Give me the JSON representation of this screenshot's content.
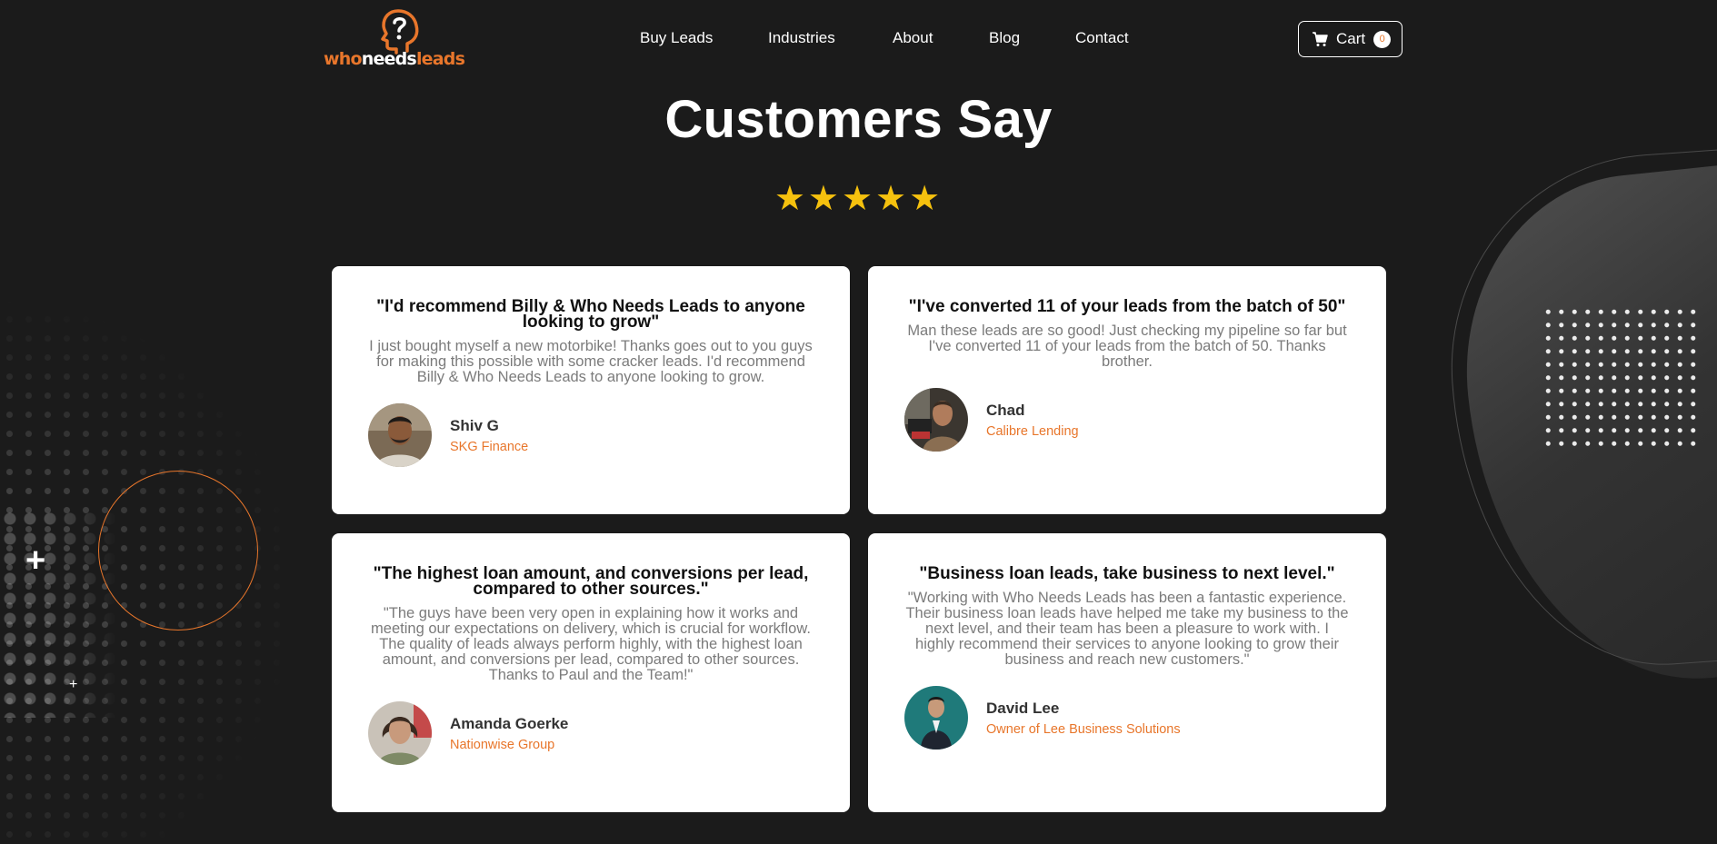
{
  "brand": {
    "logo_part1": "who",
    "logo_part2": "needs",
    "logo_part3": "leads",
    "accent": "#e8762b"
  },
  "nav": [
    {
      "label": "Buy Leads"
    },
    {
      "label": "Industries"
    },
    {
      "label": "About"
    },
    {
      "label": "Blog"
    },
    {
      "label": "Contact"
    }
  ],
  "cart": {
    "label": "Cart",
    "count": "0",
    "icon": "cart-icon"
  },
  "section": {
    "title": "Customers Say",
    "stars": "★★★★★",
    "rating": 5
  },
  "testimonials": [
    {
      "title": "\"I'd recommend Billy & Who Needs Leads to anyone looking to grow\"",
      "body": "I just bought myself a new motorbike! Thanks goes out to you guys for making this possible with some cracker leads. I'd recommend Billy & Who Needs Leads to anyone looking to grow.",
      "name": "Shiv G",
      "company": "SKG Finance"
    },
    {
      "title": "\"I've converted 11 of your leads from the batch of 50\"",
      "body": "Man these leads are so good! Just checking my pipeline so far but I've converted 11 of your leads from the batch of 50. Thanks brother.",
      "name": "Chad",
      "company": "Calibre Lending"
    },
    {
      "title": "\"The highest loan amount, and conversions per lead, compared to other sources.\"",
      "body": "\"The guys have been very open in explaining how it works and meeting our expectations on delivery, which is crucial for workflow. The quality of leads always perform highly, with the highest loan amount, and conversions per lead, compared to other sources. Thanks to Paul and the Team!\"",
      "name": "Amanda Goerke",
      "company": "Nationwise Group"
    },
    {
      "title": "\"Business loan leads, take business to next level.\"",
      "body": "\"Working with Who Needs Leads has been a fantastic experience. Their business loan leads have helped me take my business to the next level, and their team has been a pleasure to work with. I highly recommend their services to anyone looking to grow their business and reach new customers.\"",
      "name": "David Lee",
      "company": "Owner of Lee Business Solutions"
    }
  ]
}
